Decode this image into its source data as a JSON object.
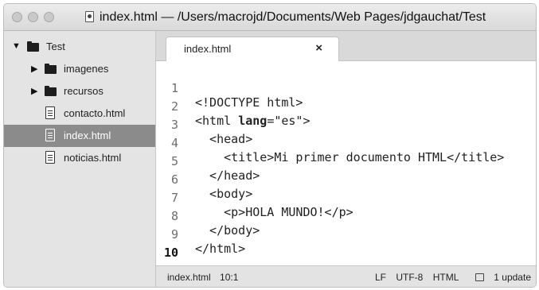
{
  "window": {
    "title": "index.html — /Users/macrojd/Documents/Web Pages/jdgauchat/Test"
  },
  "sidebar": {
    "root": {
      "label": "Test",
      "expanded": true
    },
    "items": [
      {
        "type": "folder",
        "label": "imagenes",
        "collapsed": true
      },
      {
        "type": "folder",
        "label": "recursos",
        "collapsed": true
      },
      {
        "type": "file",
        "label": "contacto.html",
        "selected": false
      },
      {
        "type": "file",
        "label": "index.html",
        "selected": true
      },
      {
        "type": "file",
        "label": "noticias.html",
        "selected": false
      }
    ]
  },
  "tabs": [
    {
      "label": "index.html",
      "active": true,
      "close_glyph": "×"
    }
  ],
  "editor": {
    "current_line": 10,
    "lines": [
      {
        "num": "1",
        "parts": [
          "<!DOCTYPE html>"
        ]
      },
      {
        "num": "2",
        "parts": [
          "<html ",
          "lang",
          "=\"es\">"
        ]
      },
      {
        "num": "3",
        "parts": [
          "  <head>"
        ]
      },
      {
        "num": "4",
        "parts": [
          "    <title>Mi primer documento HTML</title>"
        ]
      },
      {
        "num": "5",
        "parts": [
          "  </head>"
        ]
      },
      {
        "num": "6",
        "parts": [
          "  <body>"
        ]
      },
      {
        "num": "7",
        "parts": [
          "    <p>HOLA MUNDO!</p>"
        ]
      },
      {
        "num": "8",
        "parts": [
          "  </body>"
        ]
      },
      {
        "num": "9",
        "parts": [
          "</html>"
        ]
      },
      {
        "num": "10",
        "parts": [
          ""
        ]
      }
    ]
  },
  "statusbar": {
    "file": "index.html",
    "position": "10:1",
    "line_endings": "LF",
    "encoding": "UTF-8",
    "grammar": "HTML",
    "updates": "1 update"
  },
  "icons": {
    "folder": "folder-icon",
    "file": "file-icon",
    "package": "package-icon"
  }
}
